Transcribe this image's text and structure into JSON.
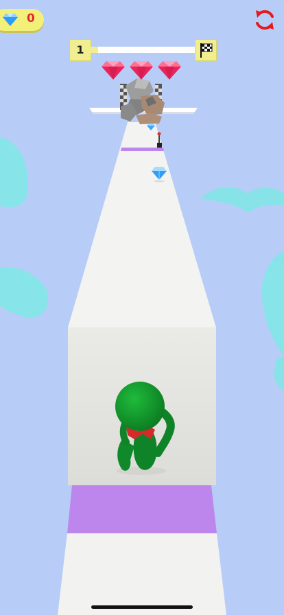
{
  "hud": {
    "gem_count": "0",
    "level": "1",
    "level_progress": 0.08,
    "bonus_rubies": 3,
    "gem_icon": "diamond-icon",
    "restart_icon": "restart-icon",
    "finish_icon": "checkered-flag-icon"
  },
  "colors": {
    "sky": "#b7cdf7",
    "track": "#f2f2f0",
    "stripe": "#bc86ec",
    "player": "#159a2e",
    "scarf": "#d62a2a",
    "hud_yellow": "#f3f07a",
    "ruby": "#e8245c",
    "restart": "#e31b1b"
  }
}
